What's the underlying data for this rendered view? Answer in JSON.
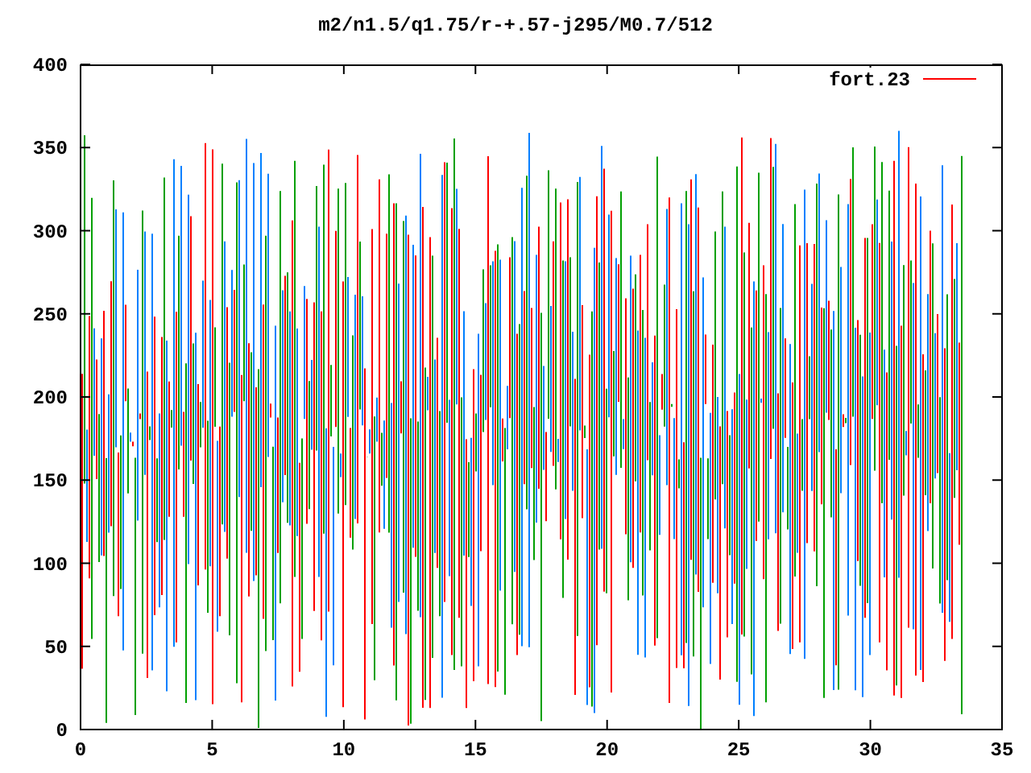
{
  "title": "m2/n1.5/q1.75/r-+.57-j295/M0.7/512",
  "legend": {
    "label": "fort.23"
  },
  "y_ticks": [
    "400",
    "350",
    "300",
    "250",
    "200",
    "150",
    "100",
    "50",
    "0"
  ],
  "x_ticks": [
    "0",
    "5",
    "10",
    "15",
    "20",
    "25",
    "30",
    "35"
  ]
}
